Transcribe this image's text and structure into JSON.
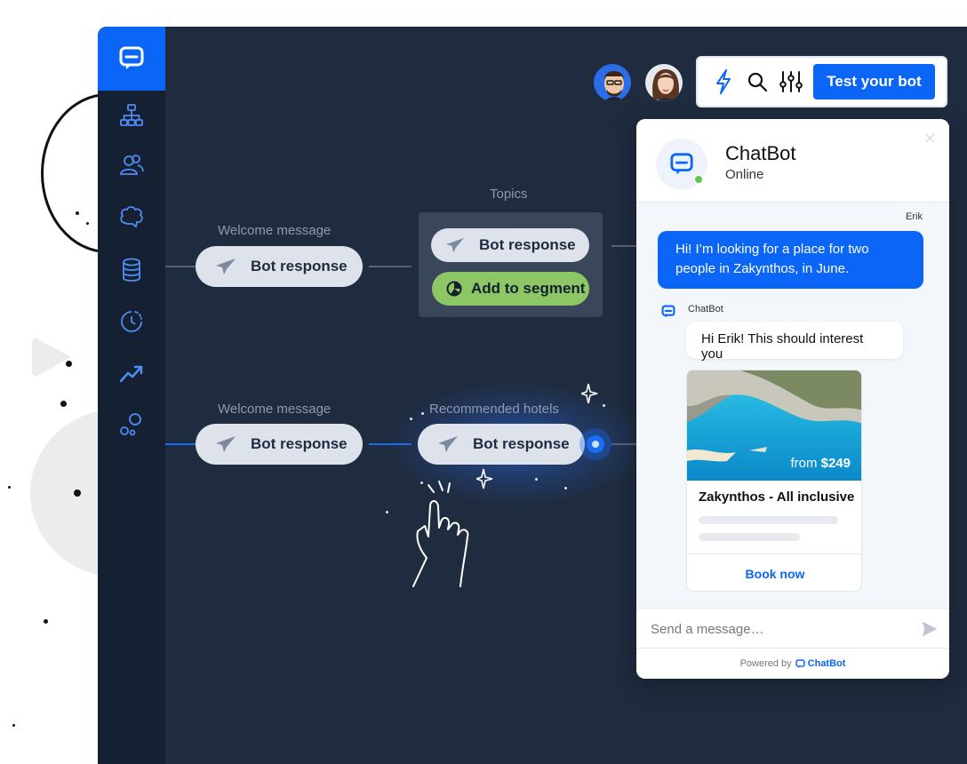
{
  "toolbar": {
    "test_button_label": "Test your bot"
  },
  "flow": {
    "row1_label": "Welcome message",
    "row1_node": "Bot response",
    "topics_label": "Topics",
    "topics_node1": "Bot response",
    "topics_node2": "Add to segment",
    "row2_label": "Welcome message",
    "row2_node": "Bot response",
    "hotels_label": "Recommended hotels",
    "hotels_node": "Bot response"
  },
  "chat": {
    "title": "ChatBot",
    "status": "Online",
    "user_name": "Erik",
    "user_message": "Hi! I’m looking for a place for two people in Zakynthos, in June.",
    "bot_name": "ChatBot",
    "bot_message": "Hi Erik! This should interest you",
    "card": {
      "price_prefix": "from",
      "price": "$249",
      "title": "Zakynthos - All inclusive",
      "button": "Book now"
    },
    "input_placeholder": "Send a message…",
    "powered_by": "Powered by",
    "powered_brand": "ChatBot"
  },
  "colors": {
    "accent": "#0b66f7",
    "canvas": "#1f2b3e",
    "sidebar": "#152033",
    "segment_green": "#8dc765",
    "online": "#5cc948"
  }
}
